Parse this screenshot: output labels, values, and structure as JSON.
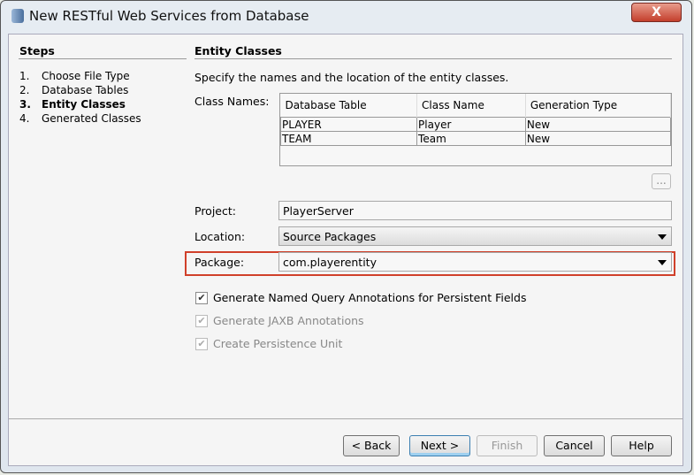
{
  "window": {
    "title": "New RESTful Web Services from Database",
    "close": "X"
  },
  "steps": {
    "heading": "Steps",
    "items": [
      {
        "n": "1.",
        "label": "Choose File Type"
      },
      {
        "n": "2.",
        "label": "Database Tables"
      },
      {
        "n": "3.",
        "label": "Entity Classes"
      },
      {
        "n": "4.",
        "label": "Generated Classes"
      }
    ]
  },
  "main": {
    "heading": "Entity Classes",
    "description": "Specify the names and the location of the entity classes.",
    "class_names_label": "Class Names:",
    "table": {
      "headers": [
        "Database Table",
        "Class Name",
        "Generation Type"
      ],
      "rows": [
        [
          "PLAYER",
          "Player",
          "New"
        ],
        [
          "TEAM",
          "Team",
          "New"
        ]
      ]
    },
    "ellipsis": "...",
    "project_label": "Project:",
    "project": "PlayerServer",
    "location_label": "Location:",
    "location": "Source Packages",
    "package_label": "Package:",
    "package": "com.playerentity",
    "checks": [
      {
        "label": "Generate Named Query Annotations for Persistent Fields",
        "checked": true,
        "enabled": true
      },
      {
        "label": "Generate JAXB Annotations",
        "checked": true,
        "enabled": false
      },
      {
        "label": "Create Persistence Unit",
        "checked": true,
        "enabled": false
      }
    ]
  },
  "buttons": {
    "back": "< Back",
    "next": "Next >",
    "finish": "Finish",
    "cancel": "Cancel",
    "help": "Help"
  },
  "colors": {
    "highlight": "#d0402a"
  }
}
